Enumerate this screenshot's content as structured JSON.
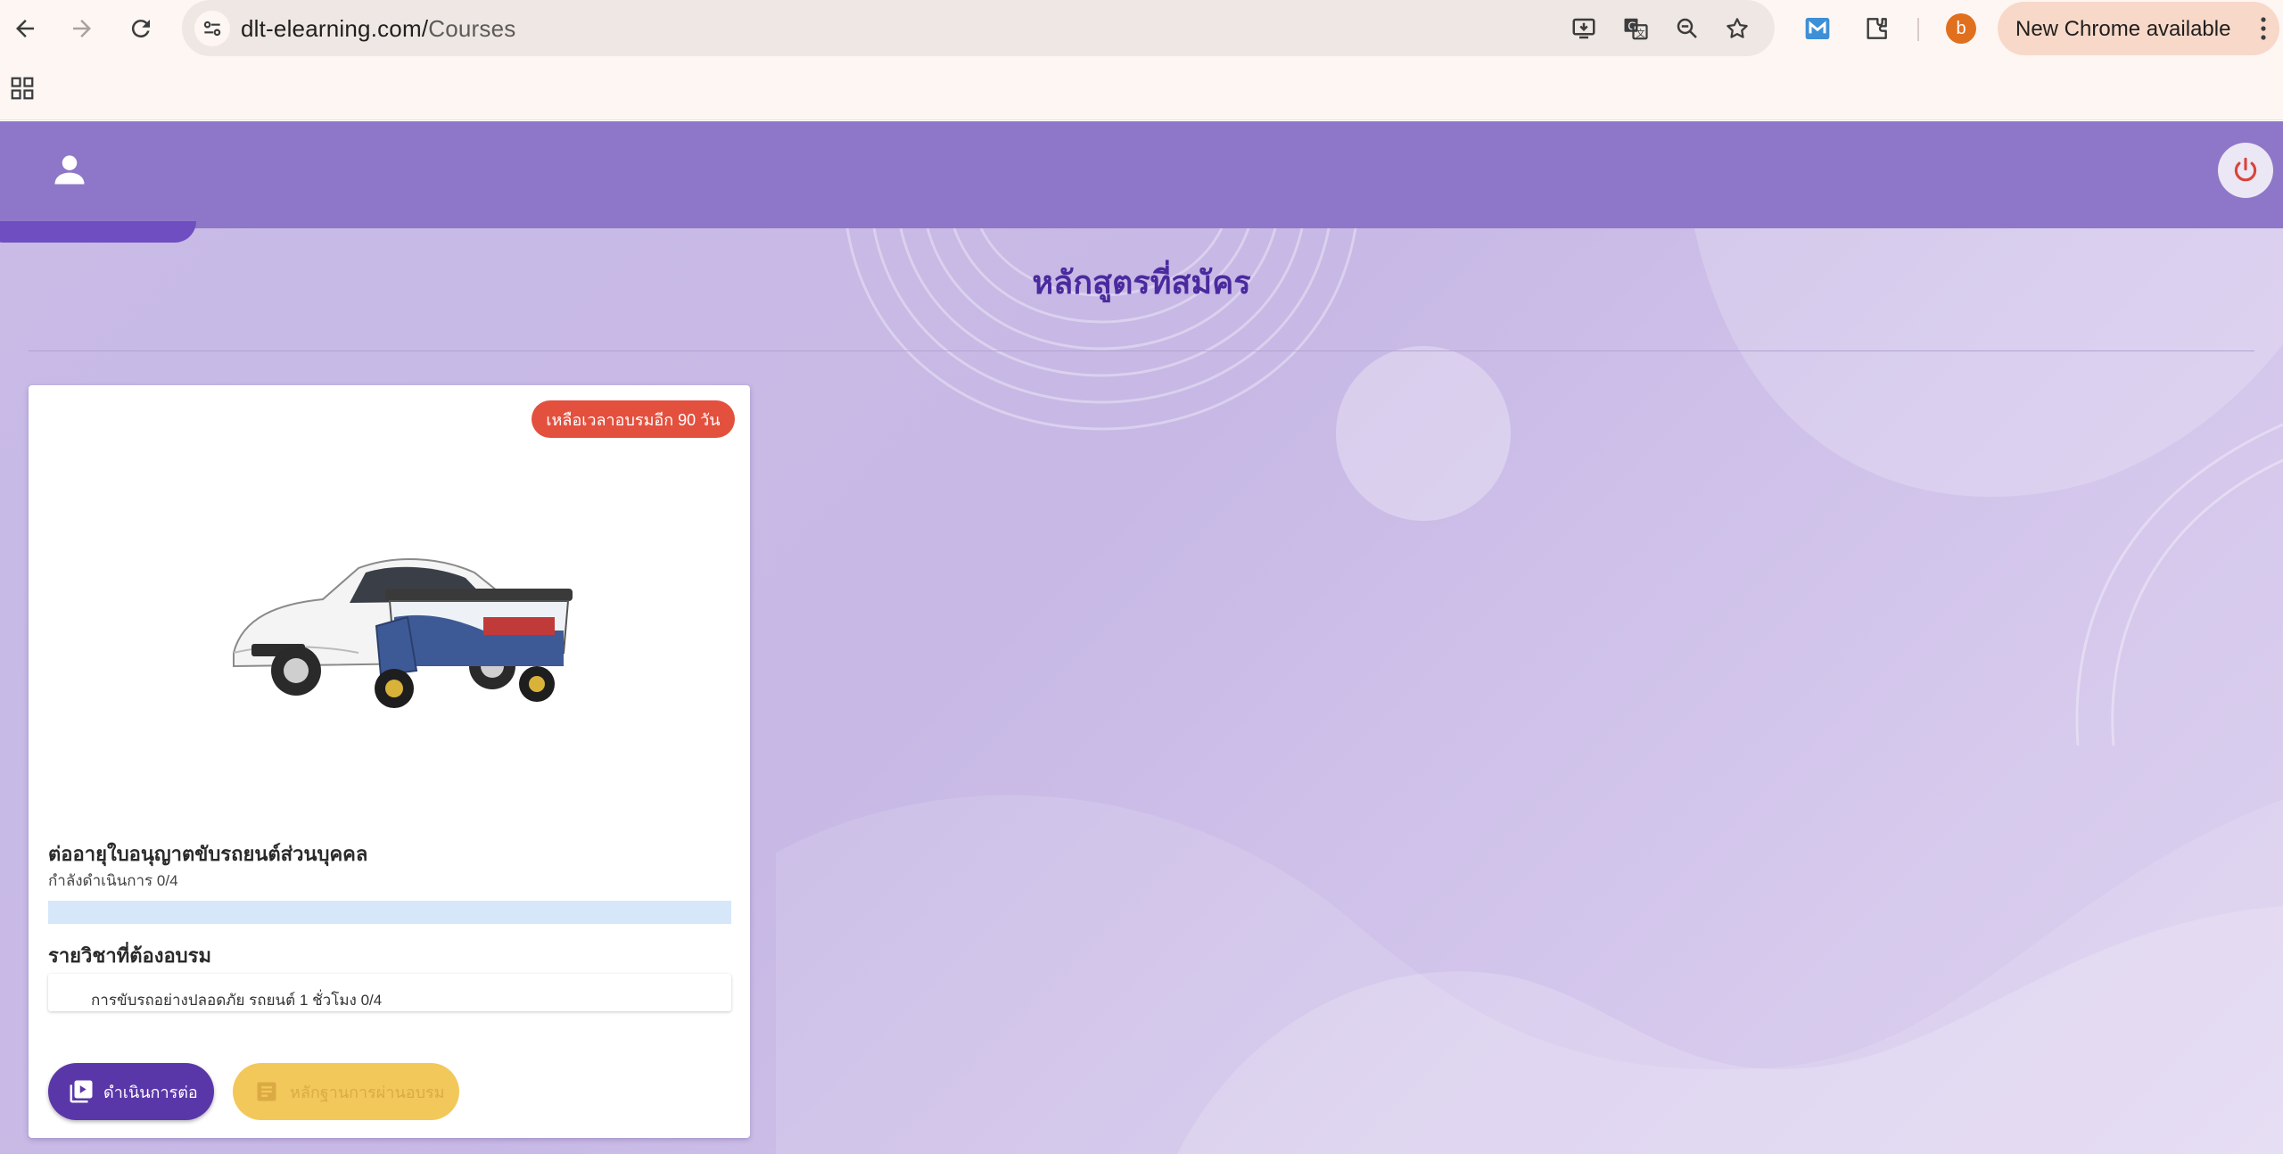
{
  "browser": {
    "url_host": "dlt-elearning.com/",
    "url_path": "Courses",
    "profile_initial": "b",
    "update_label": "New Chrome available",
    "icons": [
      "back-icon",
      "forward-icon",
      "reload-icon",
      "site-info-icon",
      "install-icon",
      "translate-icon",
      "zoom-icon",
      "star-icon",
      "extension-m-icon",
      "extensions-icon",
      "apps-grid-icon",
      "more-icon"
    ]
  },
  "page": {
    "title": "หลักสูตรที่สมัคร"
  },
  "course": {
    "badge": "เหลือเวลาอบรมอีก 90 วัน",
    "title": "ต่ออายุใบอนุญาตขับรถยนต์ส่วนบุคคล",
    "progress_text": "กำลังดำเนินการ 0/4",
    "progress_fraction": 0,
    "subjects_title": "รายวิชาที่ต้องอบรม",
    "subjects": [
      "การขับรถอย่างปลอดภัย รถยนต์ 1 ชั่วโมง 0/4"
    ],
    "continue_label": "ดำเนินการต่อ",
    "certificate_label": "หลักฐานการผ่านอบรม"
  },
  "colors": {
    "header": "#8e77c8",
    "title": "#4a2a9e",
    "badge": "#e3503e",
    "primary_button": "#5a37a8",
    "secondary_button": "#f2c85a"
  }
}
